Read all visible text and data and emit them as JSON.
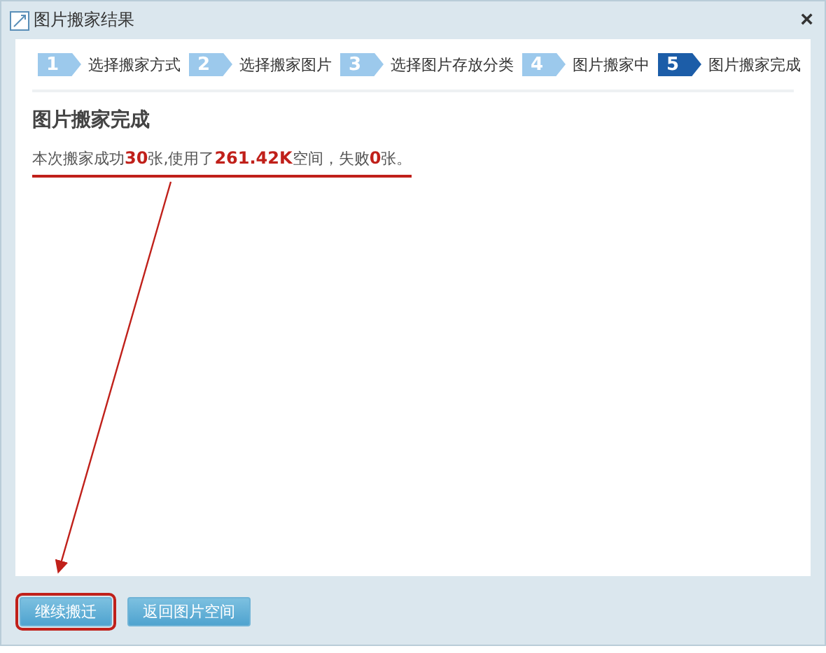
{
  "window": {
    "title": "图片搬家结果",
    "close": "×"
  },
  "steps": [
    {
      "number": "1",
      "label": "选择搬家方式",
      "selected": false
    },
    {
      "number": "2",
      "label": "选择搬家图片",
      "selected": false
    },
    {
      "number": "3",
      "label": "选择图片存放分类",
      "selected": false
    },
    {
      "number": "4",
      "label": "图片搬家中",
      "selected": false
    },
    {
      "number": "5",
      "label": "图片搬家完成",
      "selected": true
    }
  ],
  "result": {
    "heading": "图片搬家完成",
    "message": "本次搬家成功**30**张,使用了**261.42K**空间，失败**0**张。",
    "underlined": true
  },
  "arrow": true,
  "buttons": [
    {
      "label": "继续搬迁",
      "highlighted": true
    },
    {
      "label": "返回图片空间",
      "highlighted": false
    }
  ]
}
